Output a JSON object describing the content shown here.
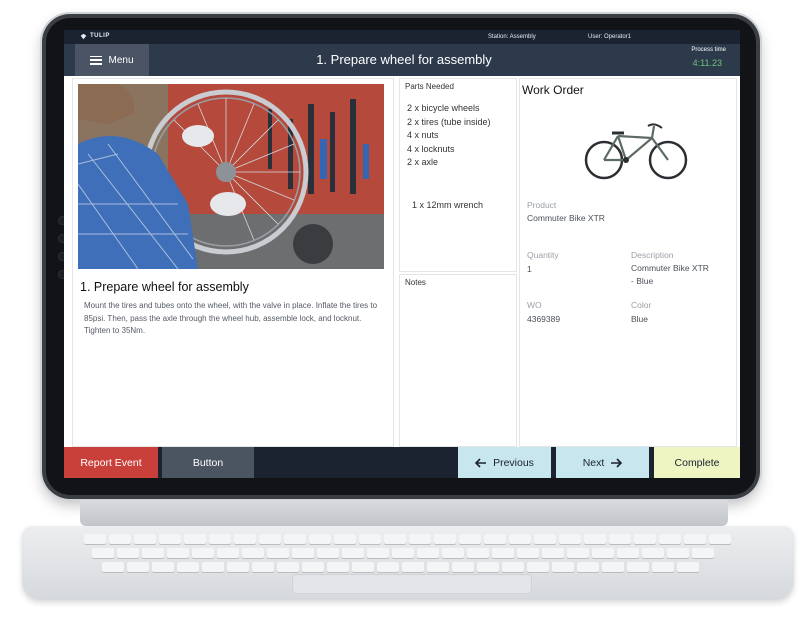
{
  "statusbar": {
    "brand": "TULIP",
    "station": "Station: Assembly",
    "user": "User: Operator1"
  },
  "header": {
    "menu_label": "Menu",
    "step_title": "1. Prepare wheel for assembly",
    "process_time_label": "Process time",
    "process_time_value": "4:11.23",
    "process_time_color": "#6fc277"
  },
  "instructions": {
    "title": "1. Prepare wheel for assembly",
    "text": "Mount the tires and tubes onto the wheel, with the valve in place. Inflate the tires to 85psi. Then, pass the axle through the wheel hub, assemble lock, and locknut. Tighten to 35Nm."
  },
  "parts": {
    "title": "Parts Needed",
    "items": [
      "2 x bicycle wheels",
      "2 x tires (tube inside)",
      "4 x nuts",
      "4 x locknuts",
      "2 x axle"
    ],
    "tool": "1 x 12mm wrench"
  },
  "notes": {
    "title": "Notes"
  },
  "work_order": {
    "title": "Work Order",
    "product_label": "Product",
    "product_value": "Commuter Bike XTR",
    "quantity_label": "Quantity",
    "quantity_value": "1",
    "description_label": "Description",
    "description_value": "Commuter Bike XTR - Blue",
    "wo_label": "WO",
    "wo_value": "4369389",
    "color_label": "Color",
    "color_value": "Blue"
  },
  "bottombar": {
    "report_label": "Report Event",
    "button_label": "Button",
    "previous_label": "Previous",
    "next_label": "Next",
    "complete_label": "Complete",
    "report_color": "#c9403a",
    "nav_color": "#c7e6ee",
    "complete_color": "#eef5c2"
  }
}
